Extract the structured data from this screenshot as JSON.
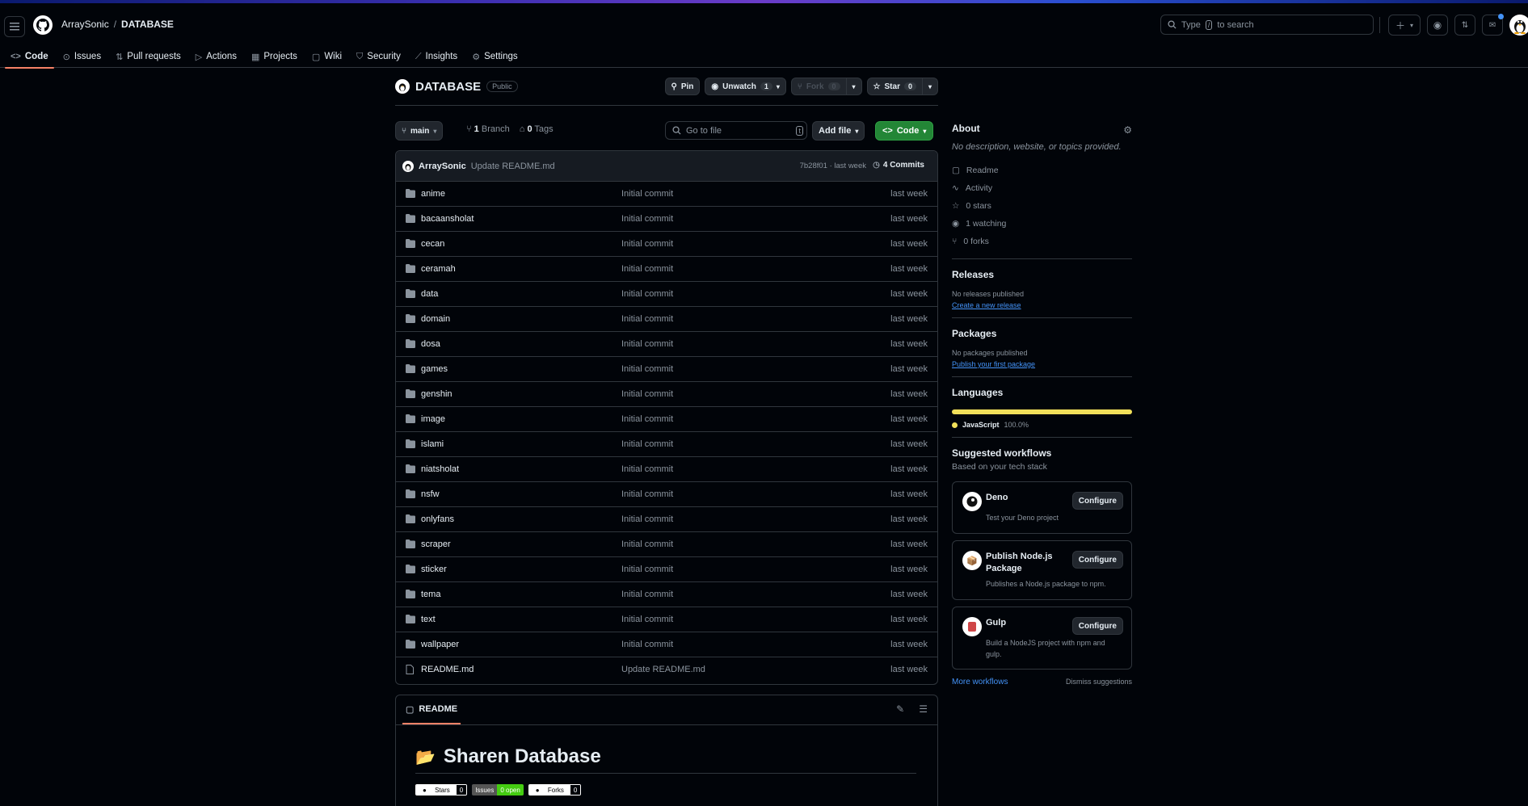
{
  "header": {
    "owner": "ArraySonic",
    "separator": "/",
    "repo": "DATABASE",
    "search": {
      "prefix": "Type",
      "key": "/",
      "suffix": "to search"
    }
  },
  "tabs": [
    {
      "label": "Code",
      "icon": "code-icon",
      "active": true
    },
    {
      "label": "Issues",
      "icon": "issue-icon"
    },
    {
      "label": "Pull requests",
      "icon": "pull-request-icon"
    },
    {
      "label": "Actions",
      "icon": "play-icon"
    },
    {
      "label": "Projects",
      "icon": "table-icon"
    },
    {
      "label": "Wiki",
      "icon": "book-icon"
    },
    {
      "label": "Security",
      "icon": "shield-icon"
    },
    {
      "label": "Insights",
      "icon": "graph-icon"
    },
    {
      "label": "Settings",
      "icon": "gear-icon"
    }
  ],
  "repo": {
    "name": "DATABASE",
    "visibility": "Public",
    "pin_label": "Pin",
    "unwatch_label": "Unwatch",
    "watch_count": "1",
    "fork_label": "Fork",
    "fork_count": "0",
    "star_label": "Star",
    "star_count": "0"
  },
  "toolbar": {
    "branch": "main",
    "branches_count": "1",
    "branches_label": "Branch",
    "tags_count": "0",
    "tags_label": "Tags",
    "goto_placeholder": "Go to file",
    "goto_key": "t",
    "add_file": "Add file",
    "code": "Code"
  },
  "commit": {
    "author": "ArraySonic",
    "message": "Update README.md",
    "sha_date": "7b28f01 · last week",
    "commits_label": "4 Commits"
  },
  "files": [
    {
      "name": "anime",
      "message": "Initial commit",
      "date": "last week",
      "type": "dir"
    },
    {
      "name": "bacaansholat",
      "message": "Initial commit",
      "date": "last week",
      "type": "dir"
    },
    {
      "name": "cecan",
      "message": "Initial commit",
      "date": "last week",
      "type": "dir"
    },
    {
      "name": "ceramah",
      "message": "Initial commit",
      "date": "last week",
      "type": "dir"
    },
    {
      "name": "data",
      "message": "Initial commit",
      "date": "last week",
      "type": "dir"
    },
    {
      "name": "domain",
      "message": "Initial commit",
      "date": "last week",
      "type": "dir"
    },
    {
      "name": "dosa",
      "message": "Initial commit",
      "date": "last week",
      "type": "dir"
    },
    {
      "name": "games",
      "message": "Initial commit",
      "date": "last week",
      "type": "dir"
    },
    {
      "name": "genshin",
      "message": "Initial commit",
      "date": "last week",
      "type": "dir"
    },
    {
      "name": "image",
      "message": "Initial commit",
      "date": "last week",
      "type": "dir"
    },
    {
      "name": "islami",
      "message": "Initial commit",
      "date": "last week",
      "type": "dir"
    },
    {
      "name": "niatsholat",
      "message": "Initial commit",
      "date": "last week",
      "type": "dir"
    },
    {
      "name": "nsfw",
      "message": "Initial commit",
      "date": "last week",
      "type": "dir"
    },
    {
      "name": "onlyfans",
      "message": "Initial commit",
      "date": "last week",
      "type": "dir"
    },
    {
      "name": "scraper",
      "message": "Initial commit",
      "date": "last week",
      "type": "dir"
    },
    {
      "name": "sticker",
      "message": "Initial commit",
      "date": "last week",
      "type": "dir"
    },
    {
      "name": "tema",
      "message": "Initial commit",
      "date": "last week",
      "type": "dir"
    },
    {
      "name": "text",
      "message": "Initial commit",
      "date": "last week",
      "type": "dir"
    },
    {
      "name": "wallpaper",
      "message": "Initial commit",
      "date": "last week",
      "type": "dir"
    },
    {
      "name": "README.md",
      "message": "Update README.md",
      "date": "last week",
      "type": "file"
    }
  ],
  "readme": {
    "tab": "README",
    "heading_emoji": "📂",
    "heading": "Sharen Database",
    "badges": [
      {
        "label": "Stars",
        "value": "0",
        "color": "#ffffff"
      },
      {
        "label": "Issues",
        "value": "0 open",
        "color": "#4c1"
      },
      {
        "label": "Forks",
        "value": "0",
        "color": "#ffffff"
      }
    ]
  },
  "about": {
    "title": "About",
    "description": "No description, website, or topics provided.",
    "items": [
      {
        "label": "Readme",
        "icon": "book-icon"
      },
      {
        "label": "Activity",
        "icon": "pulse-icon"
      },
      {
        "label": "0 stars",
        "icon": "star-icon"
      },
      {
        "label": "1 watching",
        "icon": "eye-icon"
      },
      {
        "label": "0 forks",
        "icon": "fork-icon"
      }
    ]
  },
  "releases": {
    "title": "Releases",
    "text": "No releases published",
    "link": "Create a new release"
  },
  "packages": {
    "title": "Packages",
    "text": "No packages published",
    "link": "Publish your first package"
  },
  "languages": {
    "title": "Languages",
    "items": [
      {
        "name": "JavaScript",
        "percent": "100.0%",
        "color": "#f1e05a"
      }
    ]
  },
  "workflows": {
    "title": "Suggested workflows",
    "subtitle": "Based on your tech stack",
    "items": [
      {
        "name": "Deno",
        "desc": "Test your Deno project",
        "button": "Configure"
      },
      {
        "name": "Publish Node.js Package",
        "desc": "Publishes a Node.js package to npm.",
        "button": "Configure"
      },
      {
        "name": "Gulp",
        "desc": "Build a NodeJS project with npm and gulp.",
        "button": "Configure"
      }
    ],
    "more": "More workflows",
    "dismiss": "Dismiss suggestions"
  }
}
